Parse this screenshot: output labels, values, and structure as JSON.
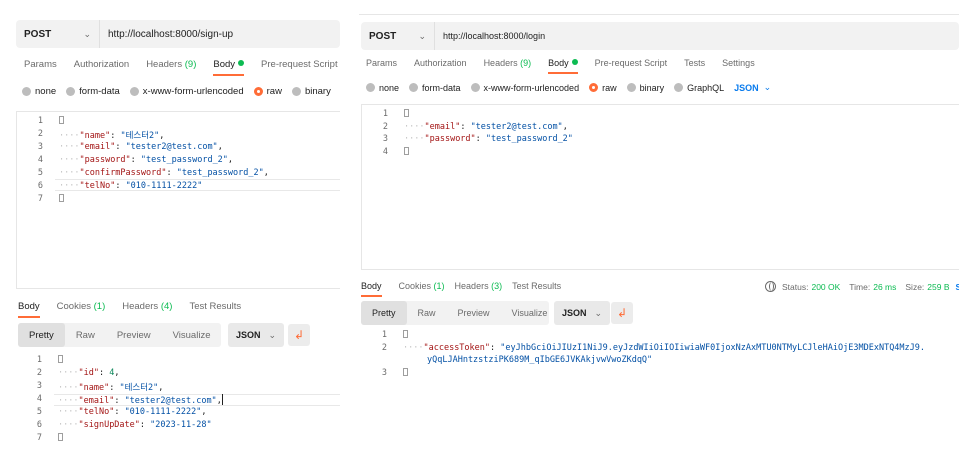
{
  "left": {
    "method": "POST",
    "url": "http://localhost:8000/sign-up",
    "tabs": [
      {
        "label": "Params"
      },
      {
        "label": "Authorization"
      },
      {
        "label": "Headers",
        "count": "(9)"
      },
      {
        "label": "Body"
      },
      {
        "label": "Pre-request Script"
      }
    ],
    "body_types": [
      "none",
      "form-data",
      "x-www-form-urlencoded",
      "raw",
      "binary"
    ],
    "request_lines": [
      {
        "n": "1",
        "t": "{"
      },
      {
        "n": "2",
        "k": "\"name\"",
        "v": "\"테스터2\"",
        "vt": "s",
        "c": ","
      },
      {
        "n": "3",
        "k": "\"email\"",
        "v": "\"tester2@test.com\"",
        "vt": "s",
        "c": ","
      },
      {
        "n": "4",
        "k": "\"password\"",
        "v": "\"test_password_2\"",
        "vt": "s",
        "c": ","
      },
      {
        "n": "5",
        "k": "\"confirmPassword\"",
        "v": "\"test_password_2\"",
        "vt": "s",
        "c": ","
      },
      {
        "n": "6",
        "k": "\"telNo\"",
        "v": "\"010-1111-2222\"",
        "vt": "s",
        "c": ""
      },
      {
        "n": "7",
        "t": "}"
      }
    ],
    "response_tabs": [
      {
        "label": "Body"
      },
      {
        "label": "Cookies",
        "count": "(1)"
      },
      {
        "label": "Headers",
        "count": "(4)"
      },
      {
        "label": "Test Results"
      }
    ],
    "view_modes": [
      "Pretty",
      "Raw",
      "Preview",
      "Visualize"
    ],
    "format": "JSON",
    "response_lines": [
      {
        "n": "1",
        "t": "{"
      },
      {
        "n": "2",
        "k": "\"id\"",
        "v": "4",
        "vt": "n",
        "c": ","
      },
      {
        "n": "3",
        "k": "\"name\"",
        "v": "\"테스터2\"",
        "vt": "s",
        "c": ","
      },
      {
        "n": "4",
        "k": "\"email\"",
        "v": "\"tester2@test.com\"",
        "vt": "s",
        "c": ","
      },
      {
        "n": "5",
        "k": "\"telNo\"",
        "v": "\"010-1111-2222\"",
        "vt": "s",
        "c": ","
      },
      {
        "n": "6",
        "k": "\"signUpDate\"",
        "v": "\"2023-11-28\"",
        "vt": "s",
        "c": ""
      },
      {
        "n": "7",
        "t": "}"
      }
    ]
  },
  "right": {
    "method": "POST",
    "url": "http://localhost:8000/login",
    "tabs": [
      {
        "label": "Params"
      },
      {
        "label": "Authorization"
      },
      {
        "label": "Headers",
        "count": "(9)"
      },
      {
        "label": "Body"
      },
      {
        "label": "Pre-request Script"
      },
      {
        "label": "Tests"
      },
      {
        "label": "Settings"
      }
    ],
    "body_types": [
      "none",
      "form-data",
      "x-www-form-urlencoded",
      "raw",
      "binary",
      "GraphQL"
    ],
    "body_format": "JSON",
    "request_lines": [
      {
        "n": "1",
        "t": "{"
      },
      {
        "n": "2",
        "k": "\"email\"",
        "v": "\"tester2@test.com\"",
        "vt": "s",
        "c": ","
      },
      {
        "n": "3",
        "k": "\"password\"",
        "v": "\"test_password_2\"",
        "vt": "s",
        "c": ""
      },
      {
        "n": "4",
        "t": "}"
      }
    ],
    "response_tabs": [
      {
        "label": "Body"
      },
      {
        "label": "Cookies",
        "count": "(1)"
      },
      {
        "label": "Headers",
        "count": "(3)"
      },
      {
        "label": "Test Results"
      }
    ],
    "status": {
      "status_label": "Status:",
      "status_value": "200 OK",
      "time_label": "Time:",
      "time_value": "26 ms",
      "size_label": "Size:",
      "size_value": "259 B",
      "more": "S"
    },
    "view_modes": [
      "Pretty",
      "Raw",
      "Preview",
      "Visualize"
    ],
    "format": "JSON",
    "response_lines": [
      {
        "n": "1",
        "t": "{"
      },
      {
        "n": "2",
        "k": "\"accessToken\"",
        "v": "\"eyJhbGciOiJIUzI1NiJ9.eyJzdWIiOiIOIiwiaWF0IjoxNzAxMTU0NTMyLCJleHAiOjE3MDExNTQ4MzJ9.",
        "vt": "s",
        "c": ""
      },
      {
        "n": "",
        "cont": "yQqLJAHntzstziPK689M_qIbGE6JVKAkjvwVwoZKdqQ\""
      },
      {
        "n": "3",
        "t": "}"
      }
    ]
  },
  "colors": {
    "accent": "#ff6c37",
    "success": "#0cbb52",
    "link": "#097bed"
  },
  "icons": [
    "chevron-down-icon",
    "globe-icon",
    "wrap-lines-icon",
    "fold-icon"
  ]
}
